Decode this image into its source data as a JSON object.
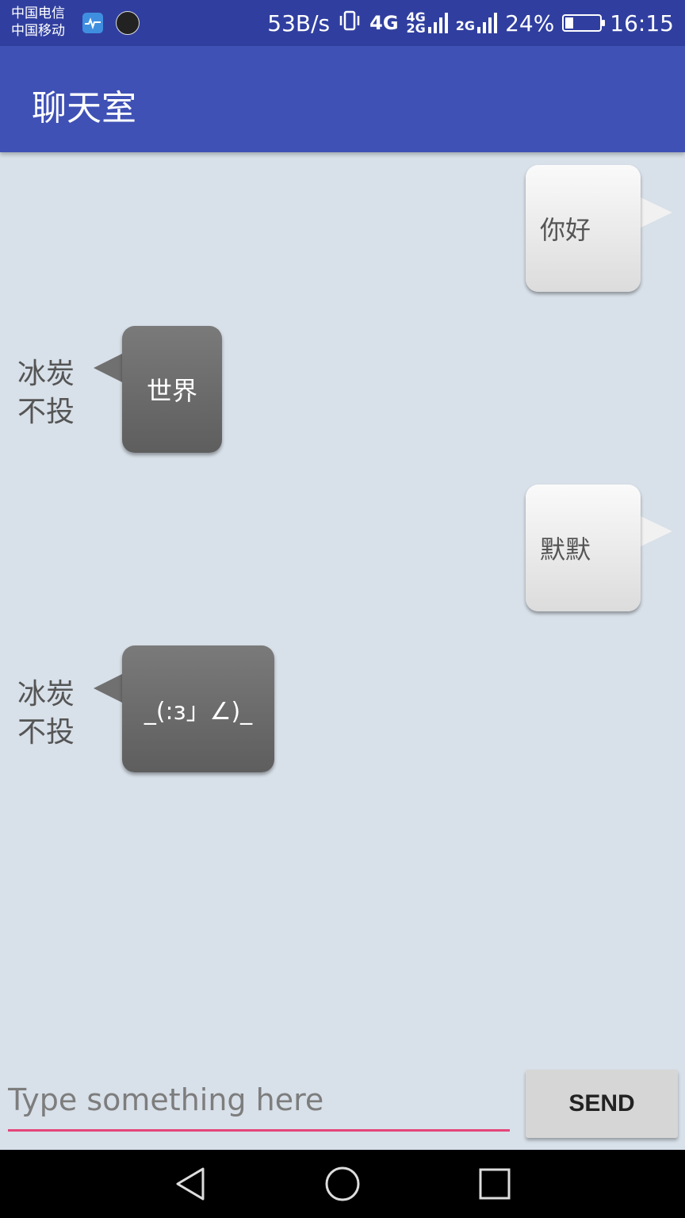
{
  "status_bar": {
    "carrier_1": "中国电信",
    "carrier_2": "中国移动",
    "net_speed": "53B/s",
    "network_1": "4G",
    "network_2_top": "4G",
    "network_2_bottom": "2G",
    "network_3": "2G",
    "battery": "24%",
    "battery_level": 0.24,
    "time": "16:15",
    "icons": [
      "health-app-icon",
      "avatar-icon",
      "vibrate-icon",
      "signal-icon",
      "battery-icon"
    ]
  },
  "app_bar": {
    "title": "聊天室"
  },
  "messages": [
    {
      "type": "sent",
      "text": "你好"
    },
    {
      "type": "received",
      "sender": "冰炭\n不投",
      "sender_line1": "冰炭",
      "sender_line2": "不投",
      "text": "世界"
    },
    {
      "type": "sent",
      "text": "默默"
    },
    {
      "type": "received",
      "sender_line1": "冰炭",
      "sender_line2": "不投",
      "text": "_(:з」∠)_"
    }
  ],
  "composer": {
    "placeholder": "Type something here",
    "value": "",
    "send_label": "SEND"
  },
  "nav_bar": {
    "icons": [
      "back-icon",
      "home-icon",
      "recents-icon"
    ]
  },
  "colors": {
    "status_bar": "#303f9f",
    "app_bar": "#3f51b5",
    "background": "#d8e0e9",
    "input_underline": "#e5457a"
  }
}
